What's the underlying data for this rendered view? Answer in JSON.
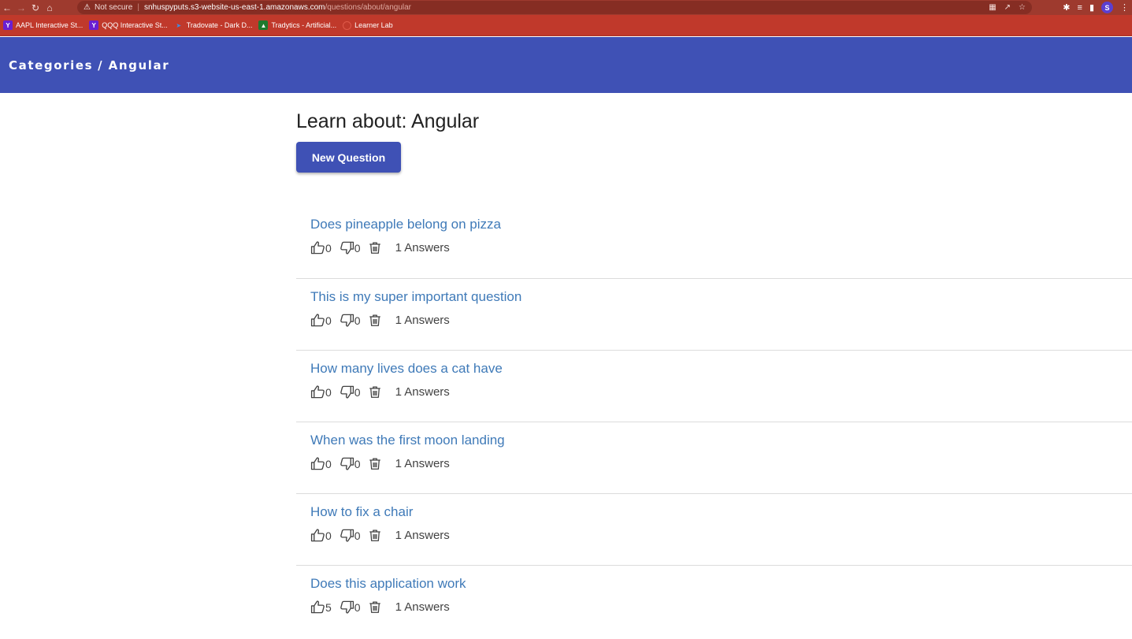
{
  "browser": {
    "not_secure_label": "Not secure",
    "url_host": "snhuspyputs.s3-website-us-east-1.amazonaws.com",
    "url_path": "/questions/about/angular",
    "profile_initial": "S",
    "bookmarks": [
      {
        "label": "AAPL Interactive St...",
        "icon": "yahoo-y"
      },
      {
        "label": "QQQ Interactive St...",
        "icon": "yahoo-y"
      },
      {
        "label": "Tradovate - Dark D...",
        "icon": "tradovate-arrow"
      },
      {
        "label": "Tradytics - Artificial...",
        "icon": "tradytics-logo"
      },
      {
        "label": "Learner Lab",
        "icon": "circle"
      }
    ]
  },
  "toolbar": {
    "crumb_root": "Categories",
    "crumb_separator": "/",
    "crumb_current": "Angular",
    "color": "#3f51b5"
  },
  "main": {
    "title": "Learn about: Angular",
    "new_question_label": "New Question"
  },
  "questions": [
    {
      "title": "Does pineapple belong on pizza",
      "up": "0",
      "down": "0",
      "answers": "1 Answers"
    },
    {
      "title": "This is my super important question",
      "up": "0",
      "down": "0",
      "answers": "1 Answers"
    },
    {
      "title": "How many lives does a cat have",
      "up": "0",
      "down": "0",
      "answers": "1 Answers"
    },
    {
      "title": "When was the first moon landing",
      "up": "0",
      "down": "0",
      "answers": "1 Answers"
    },
    {
      "title": "How to fix a chair",
      "up": "0",
      "down": "0",
      "answers": "1 Answers"
    },
    {
      "title": "Does this application work",
      "up": "5",
      "down": "0",
      "answers": "1 Answers"
    }
  ],
  "icons": {
    "thumb_up": "thumbs-up-icon",
    "thumb_down": "thumbs-down-icon",
    "delete": "trash-icon"
  }
}
